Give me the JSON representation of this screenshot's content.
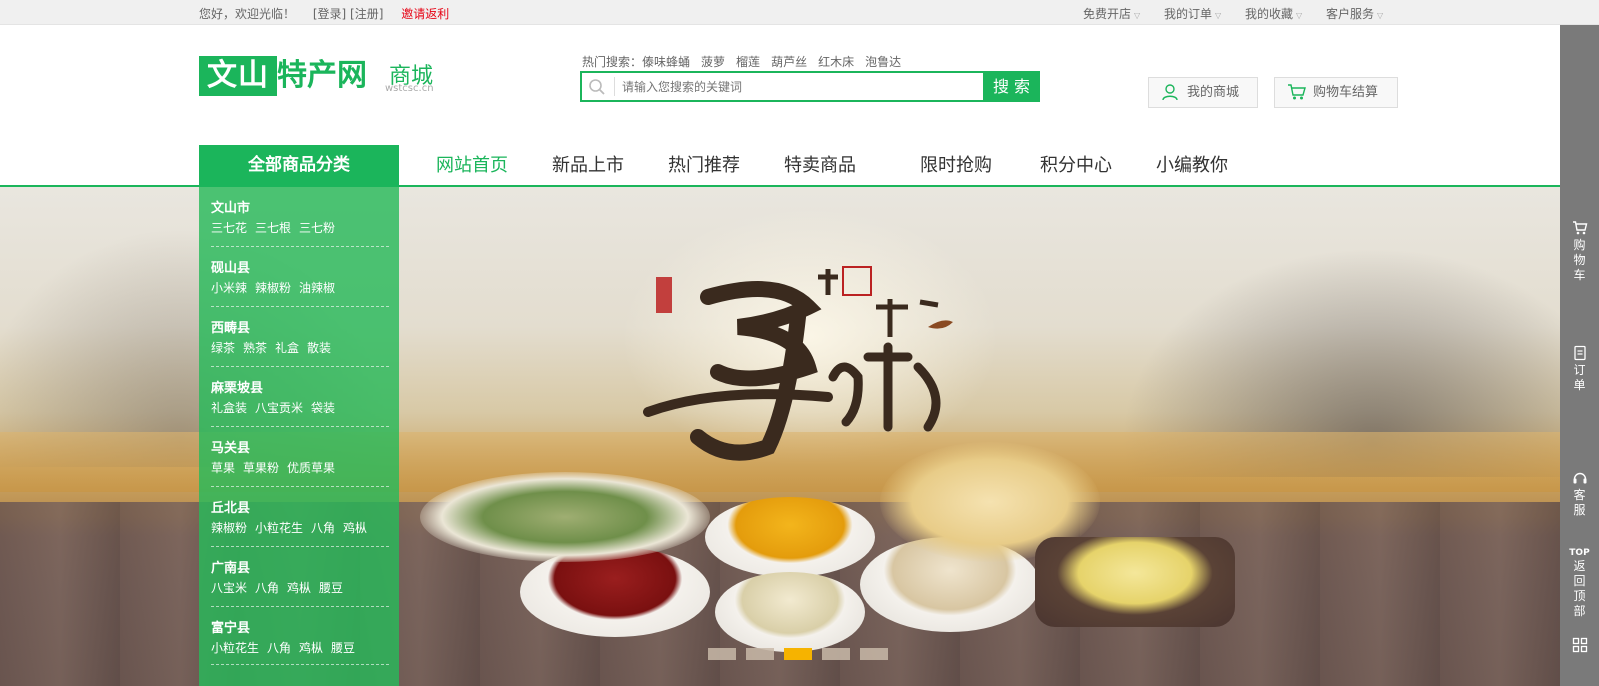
{
  "topbar": {
    "welcome": "您好，欢迎光临！",
    "login": "[登录]",
    "register": "[注册]",
    "invite": "邀请返利",
    "right_items": [
      "免费开店",
      "我的订单",
      "我的收藏",
      "客户服务"
    ]
  },
  "logo": {
    "box_text": "文山",
    "rest_text": "特产网",
    "mall_text": "商城",
    "domain": "wstcsc.cn"
  },
  "search": {
    "hot_label": "热门搜索：",
    "hot_keywords": [
      "傣味蜂蛹",
      "菠萝",
      "榴莲",
      "葫芦丝",
      "红木床",
      "泡鲁达"
    ],
    "placeholder": "请输入您搜索的关键词",
    "button": "搜 索"
  },
  "header_buttons": {
    "my_mall": "我的商城",
    "cart": "购物车结算"
  },
  "nav": {
    "category_button": "全部商品分类",
    "items": [
      "网站首页",
      "新品上市",
      "热门推荐",
      "特卖商品",
      "限时抢购",
      "积分中心",
      "小编教你"
    ],
    "active_index": 0
  },
  "categories": [
    {
      "name": "文山市",
      "subs": [
        "三七花",
        "三七根",
        "三七粉"
      ]
    },
    {
      "name": "砚山县",
      "subs": [
        "小米辣",
        "辣椒粉",
        "油辣椒"
      ]
    },
    {
      "name": "西畴县",
      "subs": [
        "绿茶",
        "熟茶",
        "礼盒",
        "散装"
      ]
    },
    {
      "name": "麻栗坡县",
      "subs": [
        "礼盒装",
        "八宝贡米",
        "袋装"
      ]
    },
    {
      "name": "马关县",
      "subs": [
        "草果",
        "草果粉",
        "优质草果"
      ]
    },
    {
      "name": "丘北县",
      "subs": [
        "辣椒粉",
        "小粒花生",
        "八角",
        "鸡枞"
      ]
    },
    {
      "name": "广南县",
      "subs": [
        "八宝米",
        "八角",
        "鸡枞",
        "腰豆"
      ]
    },
    {
      "name": "富宁县",
      "subs": [
        "小粒花生",
        "八角",
        "鸡枞",
        "腰豆"
      ]
    }
  ],
  "banner": {
    "slide_count": 5,
    "active_slide": 2
  },
  "rail": {
    "cart": "购物车",
    "orders": "订单",
    "service": "客服",
    "top_badge": "TOP",
    "back_top": "返回顶部"
  },
  "colors": {
    "brand_green": "#1bb55b",
    "invite_red": "#e60012",
    "active_dot": "#f6b300",
    "rail_gray": "#7a7a7a"
  }
}
